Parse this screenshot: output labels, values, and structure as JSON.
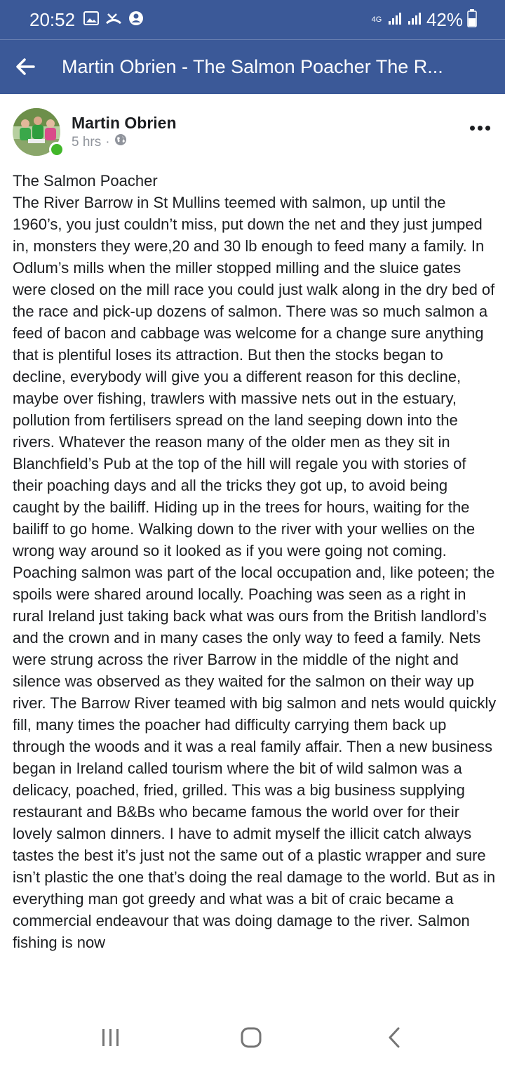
{
  "status_bar": {
    "time": "20:52",
    "network": "4G",
    "battery": "42%",
    "left_icons": [
      "image-icon",
      "missed-call-icon",
      "account-icon"
    ]
  },
  "header": {
    "title": "Martin Obrien - The Salmon Poacher The R..."
  },
  "post": {
    "author": "Martin Obrien",
    "time": "5 hrs",
    "separator": "·",
    "body": "The Salmon Poacher\nThe River Barrow in St Mullins teemed with salmon, up until the 1960’s, you just couldn’t miss, put down the net and they just jumped in, monsters they were,20 and 30 lb enough to feed many a family. In Odlum’s mills when the miller stopped milling and the sluice gates were closed on the mill race you could just walk along in the dry bed of the race and pick-up dozens of salmon. There was so much salmon a feed of bacon and cabbage was welcome for a change sure anything that is plentiful loses its attraction. But then the stocks began to decline, everybody will give you a different reason for this decline, maybe over fishing, trawlers with massive nets out in the estuary, pollution from fertilisers spread on the land seeping down into the rivers. Whatever the reason many of the older men as they sit in Blanchfield’s Pub at the top of the hill will regale you with stories of their poaching days and all the tricks they got up, to avoid being caught by the bailiff. Hiding up in the trees for hours, waiting for the bailiff to go home. Walking down to the river with your wellies on the wrong way around so it looked as if you were going not coming. Poaching salmon was part of the local occupation and, like poteen; the spoils were shared around locally. Poaching was seen as a right in rural Ireland just taking back what was ours from the British landlord’s and the crown and in many cases the only way to feed a family. Nets were strung across the river Barrow in the middle of the night and silence was observed as they waited for the salmon on their way up river. The Barrow River teamed with big salmon and nets would quickly fill, many times the poacher had difficulty carrying them back up through the woods and it was a real family affair. Then a new business began in Ireland called tourism where the bit of wild salmon was a delicacy, poached, fried, grilled. This was a big business supplying restaurant and B&Bs who became famous the world over for their lovely salmon dinners. I have to admit myself the illicit catch always tastes the best it’s just not the same out of a plastic wrapper and sure isn’t plastic the one that’s doing the real damage to the world. But as in everything man got greedy and what was a bit of craic became a commercial endeavour that was doing damage to the river. Salmon fishing is now"
  },
  "colors": {
    "brand": "#3b5998",
    "online": "#42b72a",
    "meta": "#90949c"
  }
}
